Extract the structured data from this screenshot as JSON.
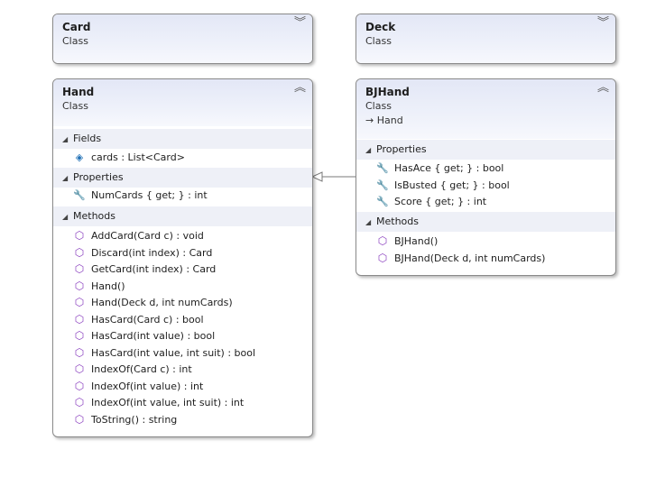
{
  "classes": {
    "card": {
      "name": "Card",
      "kind": "Class"
    },
    "deck": {
      "name": "Deck",
      "kind": "Class"
    },
    "hand": {
      "name": "Hand",
      "kind": "Class",
      "fields_label": "Fields",
      "fields": [
        "cards : List<Card>"
      ],
      "properties_label": "Properties",
      "properties": [
        "NumCards { get; } : int"
      ],
      "methods_label": "Methods",
      "methods": [
        "AddCard(Card c) : void",
        "Discard(int index) : Card",
        "GetCard(int index) : Card",
        "Hand()",
        "Hand(Deck d, int numCards)",
        "HasCard(Card c) : bool",
        "HasCard(int value) : bool",
        "HasCard(int value, int suit) : bool",
        "IndexOf(Card c) : int",
        "IndexOf(int value) : int",
        "IndexOf(int value, int suit) : int",
        "ToString() : string"
      ]
    },
    "bjhand": {
      "name": "BJHand",
      "kind": "Class",
      "inherits": "Hand",
      "properties_label": "Properties",
      "properties": [
        "HasAce { get; } : bool",
        "IsBusted { get; } : bool",
        "Score { get; } : int"
      ],
      "methods_label": "Methods",
      "methods": [
        "BJHand()",
        "BJHand(Deck d, int numCards)"
      ]
    }
  },
  "icons": {
    "collapsed": "double-chevron-down-icon",
    "expanded": "double-chevron-up-icon",
    "section_toggle": "triangle-down-icon",
    "field": "field-icon",
    "property": "wrench-icon",
    "method": "method-cube-icon",
    "inheritance": "inherit-arrow-icon"
  },
  "colors": {
    "header_gradient_top": "#e3e7f6",
    "section_bg": "#eef0f7",
    "method_icon": "#8a3fbf",
    "field_icon": "#1f6fb5",
    "border": "#8a8a8a"
  }
}
